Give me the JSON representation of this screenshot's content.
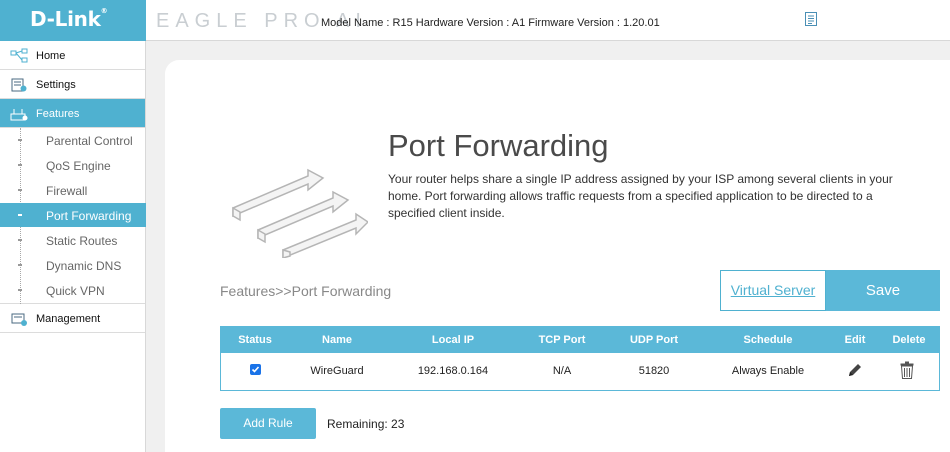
{
  "header": {
    "logo": "D-Link",
    "logo_reg": "®",
    "brand": "EAGLE PRO AI",
    "model_info": "Model Name : R15 Hardware Version : A1 Firmware Version : 1.20.01",
    "notes_icon": "document-icon"
  },
  "sidebar": {
    "items": [
      {
        "label": "Home",
        "icon": "home-network-icon"
      },
      {
        "label": "Settings",
        "icon": "settings-icon"
      },
      {
        "label": "Features",
        "icon": "features-icon",
        "active": true
      },
      {
        "label": "Management",
        "icon": "management-icon"
      }
    ],
    "sub_items": [
      {
        "label": "Parental Control"
      },
      {
        "label": "QoS Engine"
      },
      {
        "label": "Firewall"
      },
      {
        "label": "Port Forwarding",
        "active": true
      },
      {
        "label": "Static Routes"
      },
      {
        "label": "Dynamic DNS"
      },
      {
        "label": "Quick VPN"
      }
    ]
  },
  "main": {
    "title": "Port Forwarding",
    "description": "Your router helps share a single IP address assigned by your ISP among several clients in your home. Port forwarding allows traffic requests from a specified application to be directed to a specified client inside.",
    "breadcrumb": "Features>>Port Forwarding",
    "virtual_server_label": "Virtual Server",
    "save_label": "Save",
    "add_rule_label": "Add Rule",
    "remaining": "Remaining: 23"
  },
  "table": {
    "headers": [
      "Status",
      "Name",
      "Local IP",
      "TCP Port",
      "UDP Port",
      "Schedule",
      "Edit",
      "Delete"
    ],
    "rows": [
      {
        "status": "checked",
        "name": "WireGuard",
        "local_ip": "192.168.0.164",
        "tcp_port": "N/A",
        "udp_port": "51820",
        "schedule": "Always Enable"
      }
    ]
  },
  "colors": {
    "accent": "#4fb1d0",
    "button": "#5bb8d8",
    "checkbox": "#1a73e8"
  }
}
